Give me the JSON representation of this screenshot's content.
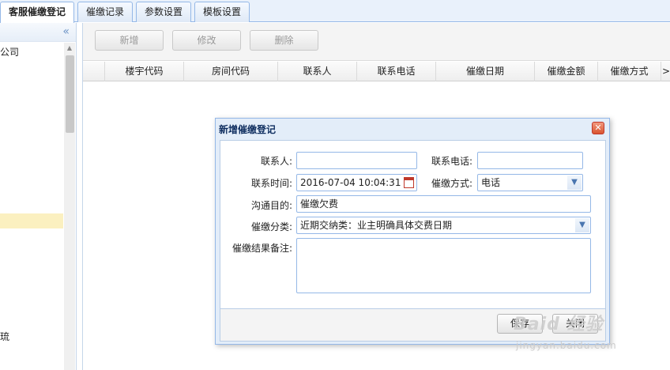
{
  "tabs": [
    {
      "label": "客服催缴登记",
      "active": true
    },
    {
      "label": "催缴记录",
      "active": false
    },
    {
      "label": "参数设置",
      "active": false
    },
    {
      "label": "模板设置",
      "active": false
    }
  ],
  "sidebar": {
    "collapse_icon": "«",
    "items": [
      {
        "label": "公司"
      },
      {
        "label": "琉"
      }
    ]
  },
  "toolbar": {
    "add_label": "新增",
    "edit_label": "修改",
    "delete_label": "删除"
  },
  "grid": {
    "columns": [
      "楼宇代码",
      "房间代码",
      "联系人",
      "联系电话",
      "催缴日期",
      "催缴金额",
      "催缴方式",
      ">"
    ]
  },
  "dialog": {
    "title": "新增催缴登记",
    "close_icon": "✕",
    "contact_label": "联系人:",
    "contact_value": "",
    "phone_label": "联系电话:",
    "phone_value": "",
    "time_label": "联系时间:",
    "time_value": "2016-07-04 10:04:31",
    "method_label": "催缴方式:",
    "method_value": "电话",
    "purpose_label": "沟通目的:",
    "purpose_value": "催缴欠费",
    "category_label": "催缴分类:",
    "category_value": "近期交纳类：业主明确具体交费日期",
    "remark_label": "催缴结果备注:",
    "remark_value": "",
    "save_label": "保存",
    "close_label": "关闭"
  },
  "watermark": {
    "logo_text": "Baid 经验",
    "sub_text": "jingyan.baidu.com"
  }
}
